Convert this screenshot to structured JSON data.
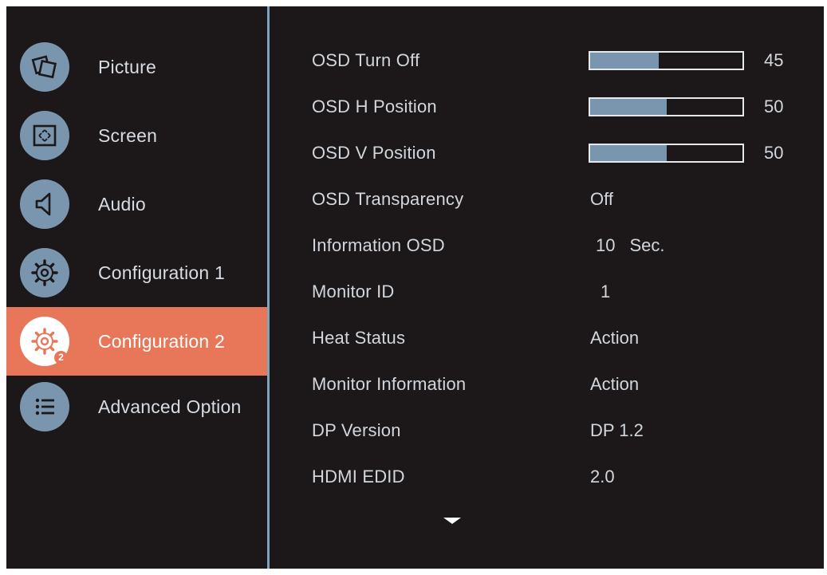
{
  "sidebar": {
    "items": [
      {
        "label": "Picture",
        "icon": "picture-icon",
        "active": false
      },
      {
        "label": "Screen",
        "icon": "screen-icon",
        "active": false
      },
      {
        "label": "Audio",
        "icon": "audio-icon",
        "active": false
      },
      {
        "label": "Configuration 1",
        "icon": "gear-icon",
        "active": false
      },
      {
        "label": "Configuration 2",
        "icon": "gear-2-icon",
        "active": true,
        "badge": "2"
      },
      {
        "label": "Advanced Option",
        "icon": "list-icon",
        "active": false
      }
    ]
  },
  "settings": {
    "osd_turn_off": {
      "label": "OSD Turn Off",
      "value": "45",
      "level": 45
    },
    "osd_h_position": {
      "label": "OSD H Position",
      "value": "50",
      "level": 50
    },
    "osd_v_position": {
      "label": "OSD V Position",
      "value": "50",
      "level": 50
    },
    "osd_transparency": {
      "label": "OSD Transparency",
      "value": "Off"
    },
    "information_osd": {
      "label": "Information OSD",
      "value": "10",
      "unit": "Sec."
    },
    "monitor_id": {
      "label": "Monitor ID",
      "value": "1"
    },
    "heat_status": {
      "label": "Heat Status",
      "value": "Action"
    },
    "monitor_information": {
      "label": "Monitor Information",
      "value": "Action"
    },
    "dp_version": {
      "label": "DP Version",
      "value": "DP 1.2"
    },
    "hdmi_edid": {
      "label": "HDMI EDID",
      "value": "2.0"
    }
  },
  "colors": {
    "background": "#1c1718",
    "accent": "#e8775a",
    "icon": "#7996ae",
    "divider": "#7fa3bd",
    "text": "#d2d7dd"
  },
  "scroll_indicator": "chevron-down-icon"
}
